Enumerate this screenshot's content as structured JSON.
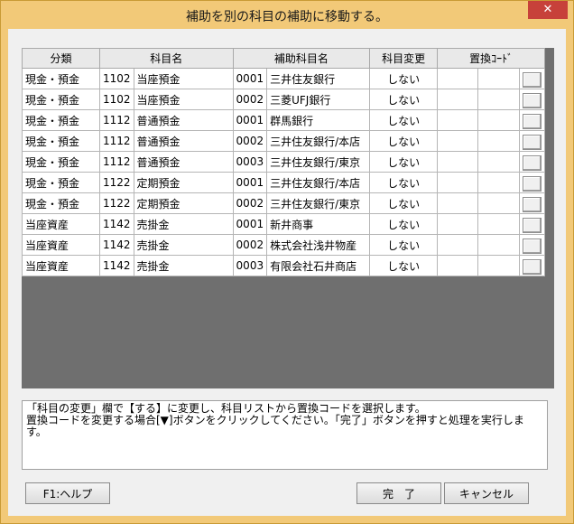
{
  "window": {
    "title": "補助を別の科目の補助に移動する。",
    "close_label": "✕"
  },
  "grid": {
    "headers": [
      "分類",
      "科目名",
      "補助科目名",
      "科目変更",
      "置換ｺｰﾄﾞ"
    ],
    "rows": [
      {
        "cat": "現金・預金",
        "code": "1102",
        "name": "当座預金",
        "sub_code": "0001",
        "sub_name": "三井住友銀行",
        "change": "しない"
      },
      {
        "cat": "現金・預金",
        "code": "1102",
        "name": "当座預金",
        "sub_code": "0002",
        "sub_name": "三菱UFJ銀行",
        "change": "しない"
      },
      {
        "cat": "現金・預金",
        "code": "1112",
        "name": "普通預金",
        "sub_code": "0001",
        "sub_name": "群馬銀行",
        "change": "しない"
      },
      {
        "cat": "現金・預金",
        "code": "1112",
        "name": "普通預金",
        "sub_code": "0002",
        "sub_name": "三井住友銀行/本店",
        "change": "しない"
      },
      {
        "cat": "現金・預金",
        "code": "1112",
        "name": "普通預金",
        "sub_code": "0003",
        "sub_name": "三井住友銀行/東京",
        "change": "しない"
      },
      {
        "cat": "現金・預金",
        "code": "1122",
        "name": "定期預金",
        "sub_code": "0001",
        "sub_name": "三井住友銀行/本店",
        "change": "しない"
      },
      {
        "cat": "現金・預金",
        "code": "1122",
        "name": "定期預金",
        "sub_code": "0002",
        "sub_name": "三井住友銀行/東京",
        "change": "しない"
      },
      {
        "cat": "当座資産",
        "code": "1142",
        "name": "売掛金",
        "sub_code": "0001",
        "sub_name": "新井商事",
        "change": "しない"
      },
      {
        "cat": "当座資産",
        "code": "1142",
        "name": "売掛金",
        "sub_code": "0002",
        "sub_name": "株式会社浅井物産",
        "change": "しない"
      },
      {
        "cat": "当座資産",
        "code": "1142",
        "name": "売掛金",
        "sub_code": "0003",
        "sub_name": "有限会社石井商店",
        "change": "しない"
      }
    ]
  },
  "message": {
    "line1": "「科目の変更」欄で【する】に変更し、科目リストから置換コードを選択します。",
    "line2": "置換コードを変更する場合[▼]ボタンをクリックしてください。「完了」ボタンを押すと処理を実行します。"
  },
  "buttons": {
    "help": "F1:ヘルプ",
    "done": "完　了",
    "cancel": "キャンセル"
  }
}
